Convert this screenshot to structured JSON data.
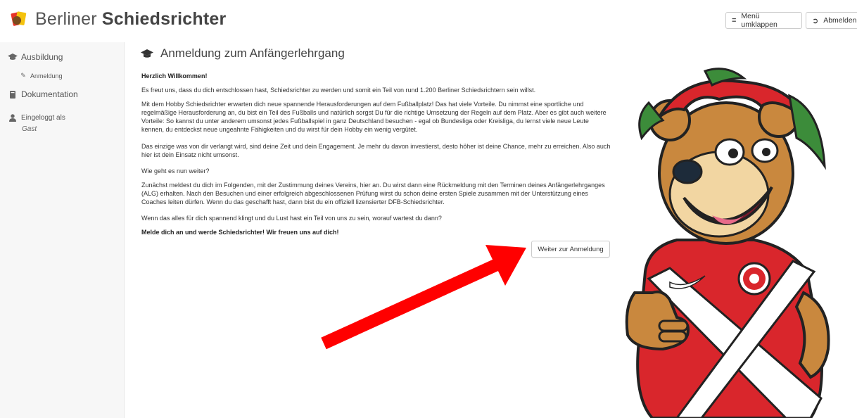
{
  "header": {
    "brand_part1": "Berliner ",
    "brand_part2": "Schiedsrichter",
    "menu_button": "Menü umklappen",
    "logout_button": "Abmelden"
  },
  "sidebar": {
    "items": [
      {
        "label": "Ausbildung",
        "icon": "graduation-cap-icon"
      },
      {
        "label": "Anmeldung",
        "icon": "pencil-icon"
      },
      {
        "label": "Dokumentation",
        "icon": "book-icon"
      },
      {
        "label": "Eingeloggt als",
        "icon": "user-icon"
      }
    ],
    "user": "Gast"
  },
  "main": {
    "title": "Anmeldung zum Anfängerlehrgang",
    "welcome": "Herzlich Willkommen!",
    "paragraphs": [
      "Es freut uns, dass du dich entschlossen hast, Schiedsrichter zu werden und somit ein Teil von rund 1.200 Berliner Schiedsrichtern sein willst.",
      "Mit dem Hobby Schiedsrichter erwarten dich neue spannende Herausforderungen auf dem Fußballplatz! Das hat viele Vorteile. Du nimmst eine sportliche und regelmäßige Herausforderung an, du bist ein Teil des Fußballs und natürlich sorgst Du für die richtige Umsetzung der Regeln auf dem Platz. Aber es gibt auch weitere Vorteile: So kannst du unter anderem umsonst jedes Fußballspiel in ganz Deutschland besuchen - egal ob Bundesliga oder Kreisliga, du lernst viele neue Leute kennen, du entdeckst neue ungeahnte Fähigkeiten und du wirst für dein Hobby ein wenig vergütet.",
      "Das einzige was von dir verlangt wird, sind deine Zeit und dein Engagement. Je mehr du davon investierst, desto höher ist deine Chance, mehr zu erreichen. Also auch hier ist dein Einsatz nicht umsonst.",
      "Wie geht es nun weiter?",
      "Zunächst meldest du dich im Folgenden, mit der Zustimmung deines Vereins, hier an. Du wirst dann eine Rückmeldung mit den Terminen deines Anfängerlehrganges (ALG) erhalten. Nach den Besuchen und einer erfolgreich abgeschlossenen Prüfung wirst du schon deine ersten Spiele zusammen mit der Unterstützung eines Coaches leiten dürfen. Wenn du das geschafft hast, dann bist du ein offiziell lizensierter DFB-Schiedsrichter.",
      "Wenn das alles für dich spannend klingt und du Lust hast ein Teil von uns zu sein, worauf wartest du dann?"
    ],
    "closing": "Melde dich an und werde Schiedsrichter! Wir freuen uns auf dich!",
    "cta_button": "Weiter zur Anmeldung"
  },
  "colors": {
    "arrow": "#ff0000",
    "sidebar_bg": "#f7f7f7",
    "mascot_shirt": "#d9262c"
  }
}
